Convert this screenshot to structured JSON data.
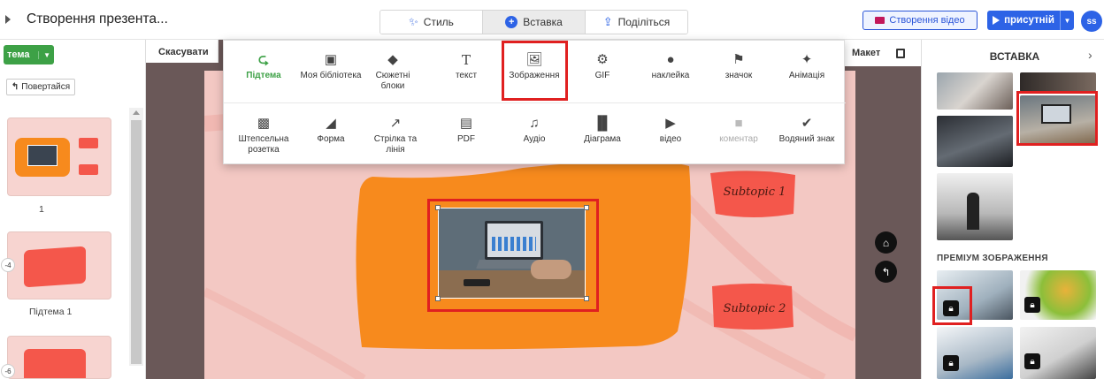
{
  "header": {
    "menu_icon": "caret-right-icon",
    "doc_title": "Створення презента...",
    "tabs": [
      {
        "label": "Стиль",
        "icon": "magic-wand-icon"
      },
      {
        "label": "Вставка",
        "icon": "plus-circle-icon",
        "active": true
      },
      {
        "label": "Поділіться",
        "icon": "share-icon"
      }
    ],
    "create_video_label": "Створення відео",
    "present_label": "присутній",
    "avatar_initials": "ss"
  },
  "sidebar": {
    "topic_button": "тема",
    "back_button": "Повертайся",
    "slides": [
      {
        "number": "1",
        "badge": ""
      },
      {
        "number": "Підтема 1",
        "badge": "-4"
      },
      {
        "number": "",
        "badge": "-6"
      }
    ]
  },
  "toolbar": {
    "cancel_label": "Скасувати",
    "layout_label": "Макет"
  },
  "insert_menu": {
    "row1": [
      {
        "label": "Підтема",
        "icon": "subtopic-icon",
        "highlight": "green"
      },
      {
        "label": "Моя бібліотека",
        "icon": "library-icon"
      },
      {
        "label": "Сюжетні блоки",
        "icon": "layers-icon"
      },
      {
        "label": "текст",
        "icon": "text-icon"
      },
      {
        "label": "Зображення",
        "icon": "image-icon",
        "selected": true
      },
      {
        "label": "GIF",
        "icon": "gif-icon"
      },
      {
        "label": "наклейка",
        "icon": "sticker-icon"
      },
      {
        "label": "значок",
        "icon": "flag-icon"
      },
      {
        "label": "Анімація",
        "icon": "animation-icon"
      }
    ],
    "row2": [
      {
        "label": "Штепсельна розетка",
        "icon": "plugin-icon"
      },
      {
        "label": "Форма",
        "icon": "shapes-icon"
      },
      {
        "label": "Стрілка та лінія",
        "icon": "arrow-icon"
      },
      {
        "label": "PDF",
        "icon": "pdf-icon"
      },
      {
        "label": "Аудіо",
        "icon": "music-icon"
      },
      {
        "label": "Діаграма",
        "icon": "chart-icon"
      },
      {
        "label": "відео",
        "icon": "video-icon"
      },
      {
        "label": "коментар",
        "icon": "comment-icon",
        "disabled": true
      },
      {
        "label": "Водяний знак",
        "icon": "watermark-icon"
      }
    ]
  },
  "canvas": {
    "subtopic1": "Subtopic 1",
    "subtopic2": "Subtopic 2",
    "home_icon": "home-icon",
    "back_icon": "back-icon"
  },
  "right_panel": {
    "title": "ВСТАВКА",
    "premium_label": "ПРЕМІУМ ЗОБРАЖЕННЯ"
  },
  "colors": {
    "accent_blue": "#2d63e6",
    "topic_green": "#3da146",
    "canvas_bg": "#f3c8c3",
    "orange_shape": "#f78a1d",
    "subtopic_red": "#f4574b",
    "highlight_red": "#e02020"
  }
}
